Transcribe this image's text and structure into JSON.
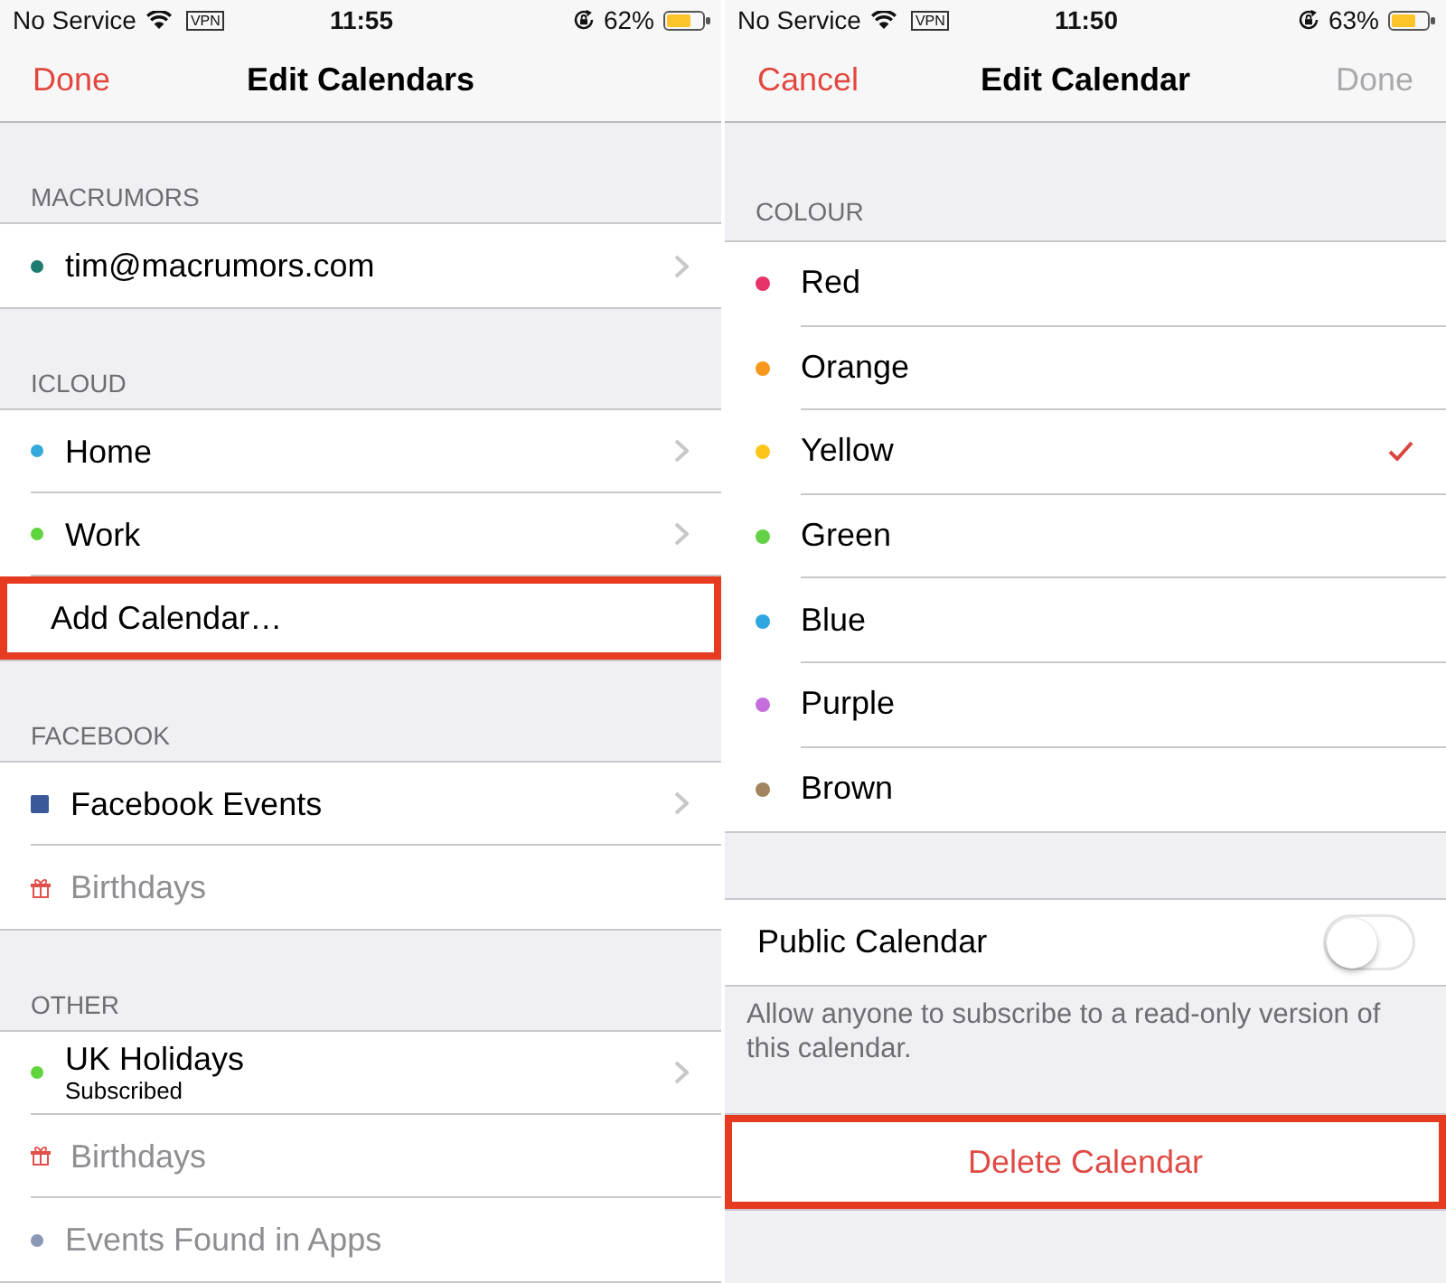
{
  "left": {
    "status_bar": {
      "carrier": "No Service",
      "vpn": "VPN",
      "time": "11:55",
      "battery": "62%"
    },
    "nav_bar": {
      "left_button": {
        "label": "Done",
        "disabled": false
      },
      "title": "Edit Calendars"
    },
    "sections": [
      {
        "header": "MACRUMORS",
        "rows": [
          {
            "kind": "calendar",
            "label": "tim@macrumors.com",
            "color": "#1f7a70",
            "disabled": false,
            "disclosure": true
          }
        ]
      },
      {
        "header": "ICLOUD",
        "rows": [
          {
            "kind": "calendar",
            "label": "Home",
            "color": "#34aadc",
            "disabled": false,
            "disclosure": true
          },
          {
            "kind": "calendar",
            "label": "Work",
            "color": "#5fd43c",
            "disabled": false,
            "disclosure": true
          },
          {
            "kind": "action",
            "label": "Add Calendar…",
            "disabled": false,
            "disclosure": false,
            "highlighted": true
          }
        ]
      },
      {
        "header": "FACEBOOK",
        "rows": [
          {
            "kind": "facebook",
            "label": "Facebook Events",
            "disabled": false,
            "disclosure": true
          },
          {
            "kind": "birthday",
            "label": "Birthdays",
            "disabled": true,
            "disclosure": false
          }
        ]
      },
      {
        "header": "OTHER",
        "rows": [
          {
            "kind": "calendar",
            "label": "UK Holidays",
            "subtitle": "Subscribed",
            "color": "#5fd43c",
            "disabled": false,
            "disclosure": true
          },
          {
            "kind": "birthday",
            "label": "Birthdays",
            "disabled": true,
            "disclosure": false
          },
          {
            "kind": "calendar",
            "label": "Events Found in Apps",
            "color": "#8b98b5",
            "disabled": true,
            "disclosure": false
          }
        ]
      }
    ]
  },
  "right": {
    "status_bar": {
      "carrier": "No Service",
      "vpn": "VPN",
      "time": "11:50",
      "battery": "63%"
    },
    "nav_bar": {
      "left_button": {
        "label": "Cancel",
        "disabled": false
      },
      "title": "Edit Calendar",
      "right_button": {
        "label": "Done",
        "disabled": true
      }
    },
    "colour_section": {
      "header": "COLOUR",
      "options": [
        {
          "label": "Red",
          "color": "#e6336a",
          "selected": false
        },
        {
          "label": "Orange",
          "color": "#f7981d",
          "selected": false
        },
        {
          "label": "Yellow",
          "color": "#fcc51a",
          "selected": true
        },
        {
          "label": "Green",
          "color": "#63d246",
          "selected": false
        },
        {
          "label": "Blue",
          "color": "#2ea6df",
          "selected": false
        },
        {
          "label": "Purple",
          "color": "#c46fdc",
          "selected": false
        },
        {
          "label": "Brown",
          "color": "#a2845e",
          "selected": false
        }
      ]
    },
    "public_calendar": {
      "label": "Public Calendar",
      "on": false,
      "footer": "Allow anyone to subscribe to a read-only version of this calendar."
    },
    "delete_button": {
      "label": "Delete Calendar",
      "highlighted": true
    }
  }
}
